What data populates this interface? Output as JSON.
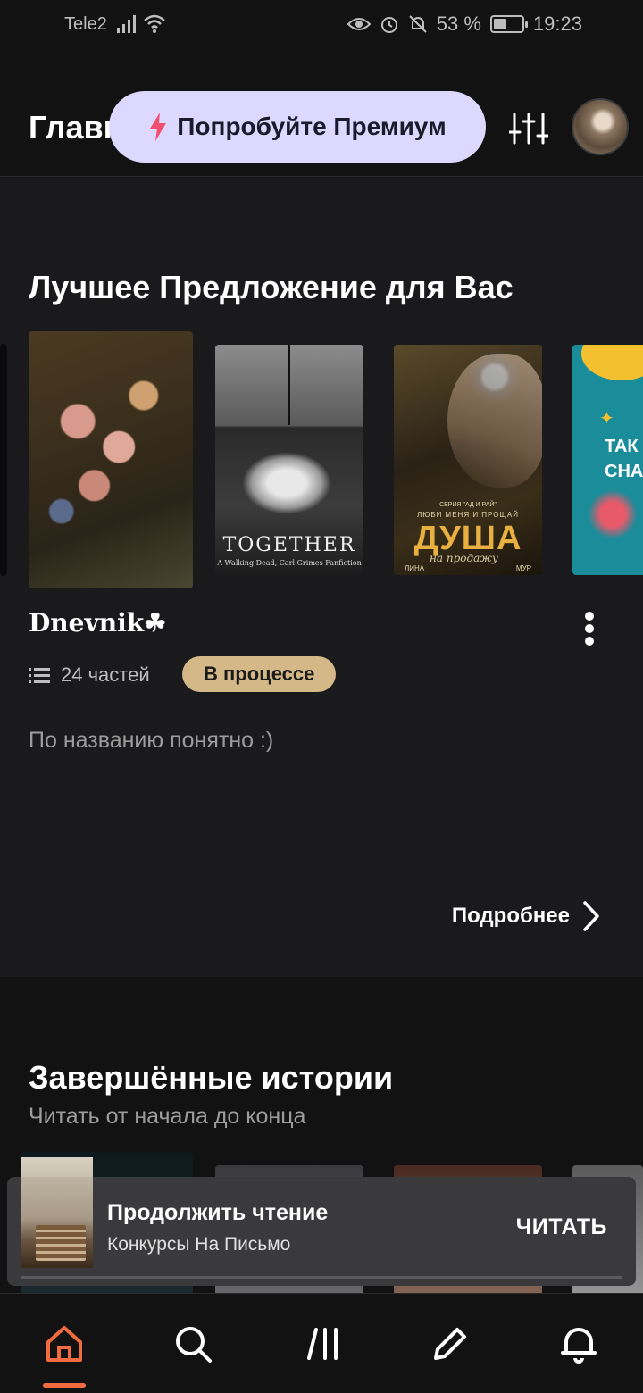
{
  "status_bar": {
    "carrier": "Tele2",
    "battery": "53 %",
    "battery_level": 0.53,
    "time": "19:23"
  },
  "header": {
    "title": "Главная",
    "premium_label": "Попробуйте Премиум",
    "premium_color": "#ddd8ff",
    "bolt_color": "#f0506e"
  },
  "offer": {
    "section_title": "Лучшее Предложение для Вас",
    "covers": [
      {
        "icon": "floral-painting-cover"
      },
      {
        "title": "TOGETHER",
        "subtitle": "A Walking Dead, Carl Grimes Fanfiction"
      },
      {
        "series": "СЕРИЯ \"АД И РАЙ\"",
        "tagline": "ЛЮБИ МЕНЯ И ПРОЩАЙ",
        "title": "ДУША",
        "script": "на продажу",
        "author_first": "ЛИНА",
        "author_last": "МУР"
      },
      {
        "title": "ТАК СНА"
      }
    ],
    "book_title": "Dnevnik☘",
    "parts": "24 частей",
    "status": "В процессе",
    "status_color": "#d5b887",
    "description": "По названию понятно :)",
    "more_label": "Подробнее"
  },
  "completed": {
    "section_title": "Завершённые истории",
    "subtitle": "Читать от начала до конца"
  },
  "continue_reading": {
    "label": "Продолжить чтение",
    "book": "Конкурсы На Письмо",
    "button": "ЧИТАТЬ"
  },
  "nav": {
    "items": [
      "home-icon",
      "search-icon",
      "library-icon",
      "pencil-icon",
      "bell-icon"
    ],
    "active": "home",
    "accent": "#f26a3d"
  }
}
